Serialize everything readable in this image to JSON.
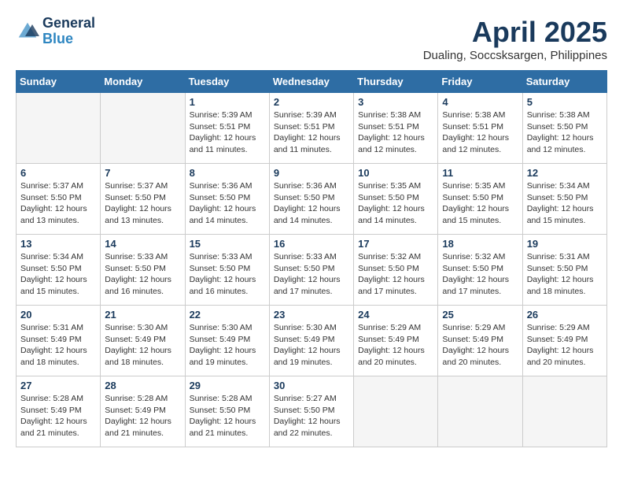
{
  "header": {
    "logo_line1": "General",
    "logo_line2": "Blue",
    "month_title": "April 2025",
    "location": "Dualing, Soccsksargen, Philippines"
  },
  "days_of_week": [
    "Sunday",
    "Monday",
    "Tuesday",
    "Wednesday",
    "Thursday",
    "Friday",
    "Saturday"
  ],
  "weeks": [
    [
      {
        "day": "",
        "info": ""
      },
      {
        "day": "",
        "info": ""
      },
      {
        "day": "1",
        "info": "Sunrise: 5:39 AM\nSunset: 5:51 PM\nDaylight: 12 hours\nand 11 minutes."
      },
      {
        "day": "2",
        "info": "Sunrise: 5:39 AM\nSunset: 5:51 PM\nDaylight: 12 hours\nand 11 minutes."
      },
      {
        "day": "3",
        "info": "Sunrise: 5:38 AM\nSunset: 5:51 PM\nDaylight: 12 hours\nand 12 minutes."
      },
      {
        "day": "4",
        "info": "Sunrise: 5:38 AM\nSunset: 5:51 PM\nDaylight: 12 hours\nand 12 minutes."
      },
      {
        "day": "5",
        "info": "Sunrise: 5:38 AM\nSunset: 5:50 PM\nDaylight: 12 hours\nand 12 minutes."
      }
    ],
    [
      {
        "day": "6",
        "info": "Sunrise: 5:37 AM\nSunset: 5:50 PM\nDaylight: 12 hours\nand 13 minutes."
      },
      {
        "day": "7",
        "info": "Sunrise: 5:37 AM\nSunset: 5:50 PM\nDaylight: 12 hours\nand 13 minutes."
      },
      {
        "day": "8",
        "info": "Sunrise: 5:36 AM\nSunset: 5:50 PM\nDaylight: 12 hours\nand 14 minutes."
      },
      {
        "day": "9",
        "info": "Sunrise: 5:36 AM\nSunset: 5:50 PM\nDaylight: 12 hours\nand 14 minutes."
      },
      {
        "day": "10",
        "info": "Sunrise: 5:35 AM\nSunset: 5:50 PM\nDaylight: 12 hours\nand 14 minutes."
      },
      {
        "day": "11",
        "info": "Sunrise: 5:35 AM\nSunset: 5:50 PM\nDaylight: 12 hours\nand 15 minutes."
      },
      {
        "day": "12",
        "info": "Sunrise: 5:34 AM\nSunset: 5:50 PM\nDaylight: 12 hours\nand 15 minutes."
      }
    ],
    [
      {
        "day": "13",
        "info": "Sunrise: 5:34 AM\nSunset: 5:50 PM\nDaylight: 12 hours\nand 15 minutes."
      },
      {
        "day": "14",
        "info": "Sunrise: 5:33 AM\nSunset: 5:50 PM\nDaylight: 12 hours\nand 16 minutes."
      },
      {
        "day": "15",
        "info": "Sunrise: 5:33 AM\nSunset: 5:50 PM\nDaylight: 12 hours\nand 16 minutes."
      },
      {
        "day": "16",
        "info": "Sunrise: 5:33 AM\nSunset: 5:50 PM\nDaylight: 12 hours\nand 17 minutes."
      },
      {
        "day": "17",
        "info": "Sunrise: 5:32 AM\nSunset: 5:50 PM\nDaylight: 12 hours\nand 17 minutes."
      },
      {
        "day": "18",
        "info": "Sunrise: 5:32 AM\nSunset: 5:50 PM\nDaylight: 12 hours\nand 17 minutes."
      },
      {
        "day": "19",
        "info": "Sunrise: 5:31 AM\nSunset: 5:50 PM\nDaylight: 12 hours\nand 18 minutes."
      }
    ],
    [
      {
        "day": "20",
        "info": "Sunrise: 5:31 AM\nSunset: 5:49 PM\nDaylight: 12 hours\nand 18 minutes."
      },
      {
        "day": "21",
        "info": "Sunrise: 5:30 AM\nSunset: 5:49 PM\nDaylight: 12 hours\nand 18 minutes."
      },
      {
        "day": "22",
        "info": "Sunrise: 5:30 AM\nSunset: 5:49 PM\nDaylight: 12 hours\nand 19 minutes."
      },
      {
        "day": "23",
        "info": "Sunrise: 5:30 AM\nSunset: 5:49 PM\nDaylight: 12 hours\nand 19 minutes."
      },
      {
        "day": "24",
        "info": "Sunrise: 5:29 AM\nSunset: 5:49 PM\nDaylight: 12 hours\nand 20 minutes."
      },
      {
        "day": "25",
        "info": "Sunrise: 5:29 AM\nSunset: 5:49 PM\nDaylight: 12 hours\nand 20 minutes."
      },
      {
        "day": "26",
        "info": "Sunrise: 5:29 AM\nSunset: 5:49 PM\nDaylight: 12 hours\nand 20 minutes."
      }
    ],
    [
      {
        "day": "27",
        "info": "Sunrise: 5:28 AM\nSunset: 5:49 PM\nDaylight: 12 hours\nand 21 minutes."
      },
      {
        "day": "28",
        "info": "Sunrise: 5:28 AM\nSunset: 5:49 PM\nDaylight: 12 hours\nand 21 minutes."
      },
      {
        "day": "29",
        "info": "Sunrise: 5:28 AM\nSunset: 5:50 PM\nDaylight: 12 hours\nand 21 minutes."
      },
      {
        "day": "30",
        "info": "Sunrise: 5:27 AM\nSunset: 5:50 PM\nDaylight: 12 hours\nand 22 minutes."
      },
      {
        "day": "",
        "info": ""
      },
      {
        "day": "",
        "info": ""
      },
      {
        "day": "",
        "info": ""
      }
    ]
  ]
}
